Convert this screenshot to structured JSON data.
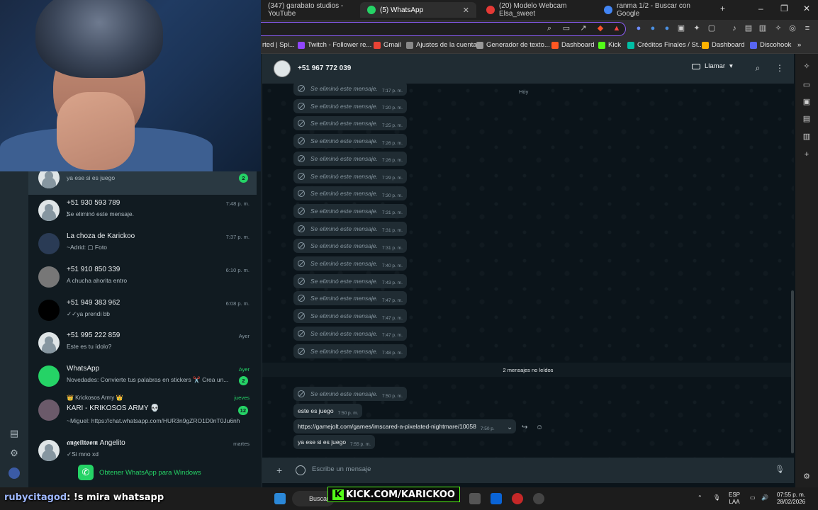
{
  "browser": {
    "tabs": [
      {
        "label": "(347) garabato studios - YouTube",
        "color": "#ff0000"
      },
      {
        "label": "(5) WhatsApp",
        "color": "#25d366",
        "active": true
      },
      {
        "label": "(20) Modelo Webcam Elsa_sweet",
        "color": "#e53935"
      },
      {
        "label": "ranma 1/2 - Buscar con Google",
        "color": "#4285f4"
      }
    ],
    "bookmarks": [
      {
        "label": "rted | Spi...",
        "color": "#888888"
      },
      {
        "label": "Twitch - Follower re...",
        "color": "#9146ff"
      },
      {
        "label": "Gmail",
        "color": "#ea4335"
      },
      {
        "label": "Ajustes de la cuenta",
        "color": "#888888"
      },
      {
        "label": "Generador de texto...",
        "color": "#888888"
      },
      {
        "label": "Dashboard",
        "color": "#ff5722"
      },
      {
        "label": "Kick",
        "color": "#53fc18"
      },
      {
        "label": "Créditos Finales / St...",
        "color": "#00bfa5"
      },
      {
        "label": "Dashboard",
        "color": "#ffb300"
      },
      {
        "label": "Discohook",
        "color": "#5865f2"
      }
    ]
  },
  "chat_list": [
    {
      "name": "",
      "preview": "ya ese si es juego",
      "time": "",
      "badge": "2",
      "selected": true,
      "avatar": "photo"
    },
    {
      "name": "+51 930 593 789",
      "preview": "⃠Se eliminó este mensaje.",
      "time": "7:48 p. m.",
      "avatar": "generic"
    },
    {
      "name": "La choza de Karickoo",
      "preview": "~Adrid: ▢ Foto",
      "time": "7:37 p. m.",
      "avatar": "photo"
    },
    {
      "name": "+51 910 850 339",
      "preview": "A chucha ahorita entro",
      "time": "6:10 p. m.",
      "avatar": "photo"
    },
    {
      "name": "+51 949 383 962",
      "preview": "✓✓ya prendi bb",
      "time": "6:08 p. m.",
      "avatar": "dark"
    },
    {
      "name": "+51 995 222 859",
      "preview": "Este es tu ídolo?",
      "time": "Ayer",
      "avatar": "generic"
    },
    {
      "name": "WhatsApp",
      "preview": "Novedades: Convierte tus palabras en stickers ✂️ Crea un...",
      "time": "Ayer",
      "badge": "2",
      "time_green": true,
      "avatar": "wa"
    },
    {
      "name": "KARI - KRIKOSOS ARMY 💀",
      "subtitle": "👑 Krickosos Army 👑",
      "preview": "~Miguel: https://chat.whatsapp.com/HUR3n9gZRO1D0nT0Ju6nh",
      "time": "jueves",
      "badge": "12",
      "time_green": true,
      "avatar": "photo"
    },
    {
      "name": "𝖆𝖓𝖌𝖊𝖑𝖎𝖙𝖔𝖔𝖒 Angelito",
      "preview": "✓Si mno xd",
      "time": "martes",
      "avatar": "generic"
    }
  ],
  "get_whatsapp": "Obtener WhatsApp para Windows",
  "chat": {
    "contact": "+51 967 772 039",
    "call_label": "Llamar",
    "day_label": "Hoy",
    "deleted_text": "Se eliminó este mensaje.",
    "deleted_times": [
      "7:17 p. m.",
      "7:20 p. m.",
      "7:25 p. m.",
      "7:26 p. m.",
      "7:26 p. m.",
      "7:29 p. m.",
      "7:30 p. m.",
      "7:31 p. m.",
      "7:31 p. m.",
      "7:31 p. m.",
      "7:40 p. m.",
      "7:43 p. m.",
      "7:47 p. m.",
      "7:47 p. m.",
      "7:47 p. m.",
      "7:48 p. m."
    ],
    "unread_label": "2 mensajes no leídos",
    "after_unread": [
      {
        "text": "Se eliminó este mensaje.",
        "time": "7:50 p. m.",
        "deleted": true
      },
      {
        "text": "este es juego",
        "time": "7:50 p. m."
      },
      {
        "text": "https://gamejolt.com/games/imscared-a-pixelated-nightmare/10058",
        "time": "7:50 p."
      },
      {
        "text": "ya ese si es juego",
        "time": "7:55 p. m."
      }
    ],
    "composer_placeholder": "Escribe un mensaje"
  },
  "taskbar": {
    "search": "Buscar",
    "lang": "ESP\nLAA",
    "time": "07:55 p. m.",
    "date": "28/02/2026",
    "kick_banner": "KICK.COM/KARICKOO"
  },
  "stream_chat": {
    "user": "rubycitagod",
    "message": ": !s mira whatsapp"
  }
}
